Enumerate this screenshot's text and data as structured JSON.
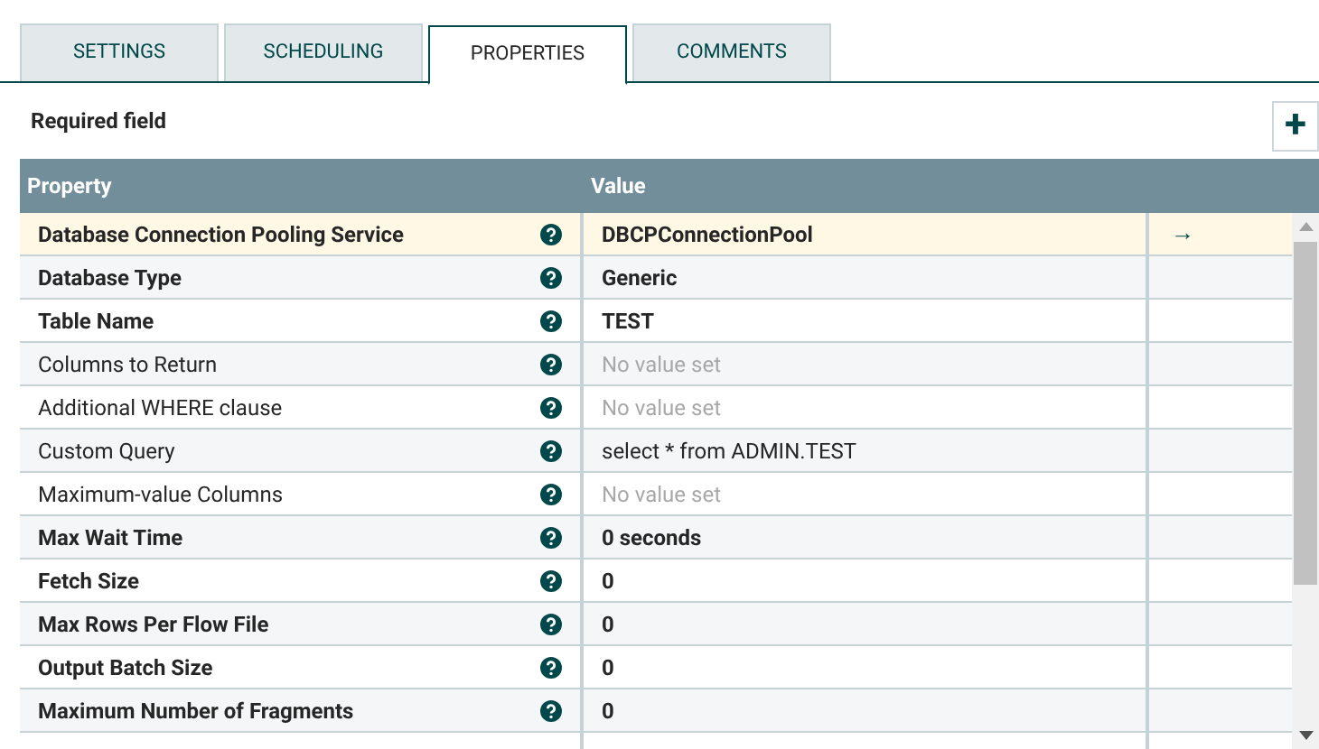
{
  "tabs": [
    {
      "label": "SETTINGS",
      "selected": false
    },
    {
      "label": "SCHEDULING",
      "selected": false
    },
    {
      "label": "PROPERTIES",
      "selected": true
    },
    {
      "label": "COMMENTS",
      "selected": false
    }
  ],
  "required_label": "Required field",
  "add_button": "+",
  "table": {
    "columns": [
      "Property",
      "Value"
    ],
    "rows": [
      {
        "property": "Database Connection Pooling Service",
        "required": true,
        "value": "DBCPConnectionPool",
        "empty": false,
        "selected": true,
        "goto": "→"
      },
      {
        "property": "Database Type",
        "required": true,
        "value": "Generic",
        "empty": false,
        "selected": false
      },
      {
        "property": "Table Name",
        "required": true,
        "value": "TEST",
        "empty": false,
        "selected": false
      },
      {
        "property": "Columns to Return",
        "required": false,
        "value": "No value set",
        "empty": true,
        "selected": false
      },
      {
        "property": "Additional WHERE clause",
        "required": false,
        "value": "No value set",
        "empty": true,
        "selected": false
      },
      {
        "property": "Custom Query",
        "required": false,
        "value": "select * from ADMIN.TEST",
        "empty": false,
        "selected": false
      },
      {
        "property": "Maximum-value Columns",
        "required": false,
        "value": "No value set",
        "empty": true,
        "selected": false
      },
      {
        "property": "Max Wait Time",
        "required": true,
        "value": "0 seconds",
        "empty": false,
        "selected": false
      },
      {
        "property": "Fetch Size",
        "required": true,
        "value": "0",
        "empty": false,
        "selected": false
      },
      {
        "property": "Max Rows Per Flow File",
        "required": true,
        "value": "0",
        "empty": false,
        "selected": false
      },
      {
        "property": "Output Batch Size",
        "required": true,
        "value": "0",
        "empty": false,
        "selected": false
      },
      {
        "property": "Maximum Number of Fragments",
        "required": true,
        "value": "0",
        "empty": false,
        "selected": false
      }
    ]
  }
}
